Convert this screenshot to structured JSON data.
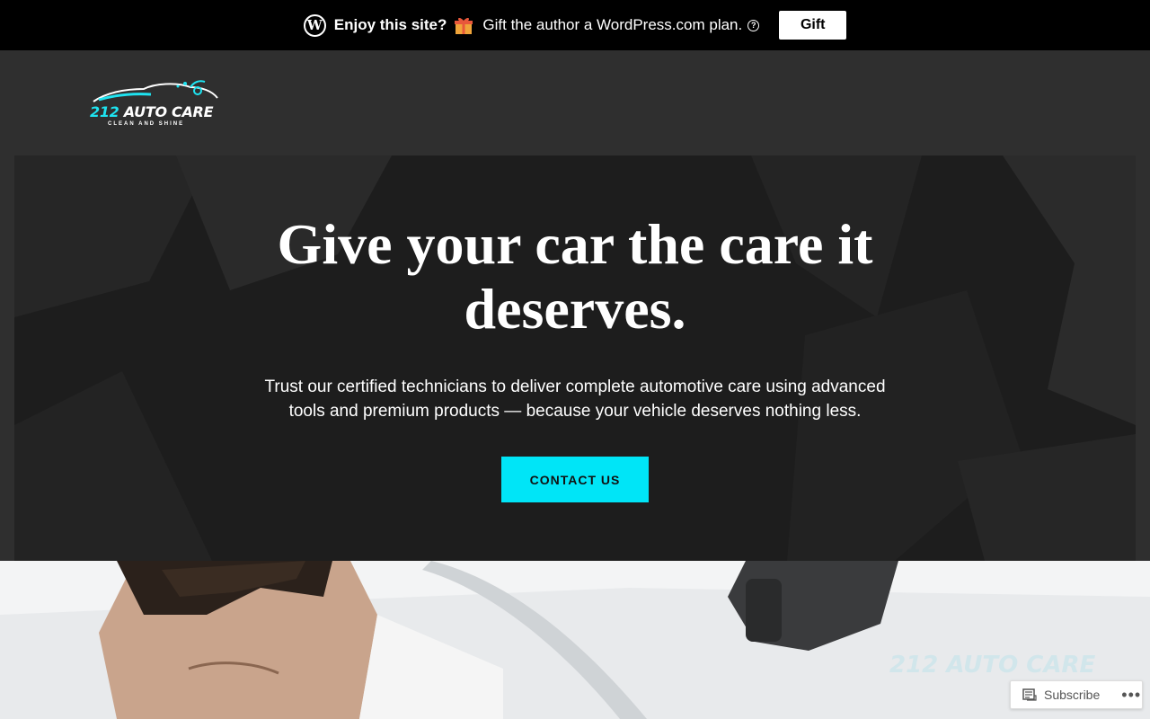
{
  "promo": {
    "logo_glyph": "W",
    "enjoy": "Enjoy this site?",
    "message": "Gift the author a WordPress.com plan.",
    "help_glyph": "?",
    "gift_label": "Gift"
  },
  "logo": {
    "number": "212",
    "name": "AUTO CARE",
    "tagline": "CLEAN AND SHINE"
  },
  "hero": {
    "title": "Give your car the care it deserves.",
    "subtitle": "Trust our certified technicians to deliver complete automotive care using advanced tools and premium products — because your vehicle deserves nothing less.",
    "cta_label": "CONTACT US"
  },
  "watermark": {
    "text": "212 AUTO CARE"
  },
  "subscribe": {
    "label": "Subscribe",
    "more": "•••"
  },
  "colors": {
    "accent": "#00e5f7",
    "banner_bg": "#000000",
    "page_bg": "#2f2f2f"
  }
}
